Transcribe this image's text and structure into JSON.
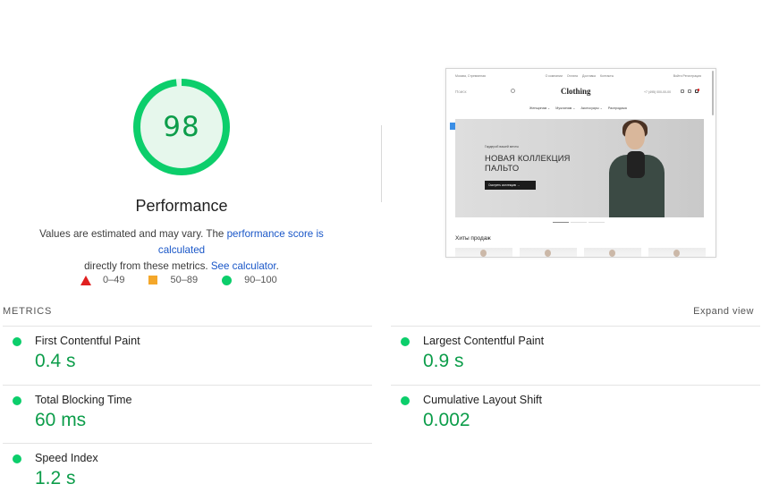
{
  "gauge": {
    "score": "98",
    "score_fraction": 0.98,
    "title": "Performance",
    "color": "#0cce6b"
  },
  "description": {
    "text_before": "Values are estimated and may vary. The ",
    "link_score": "performance score is calculated",
    "text_middle": " directly from these metrics. ",
    "link_calculator": "See calculator",
    "text_after": "."
  },
  "legend": [
    {
      "label": "0–49",
      "shape": "triangle-icon",
      "color": "#e02020"
    },
    {
      "label": "50–89",
      "shape": "square-icon",
      "color": "#f4a72a"
    },
    {
      "label": "90–100",
      "shape": "circle-icon",
      "color": "#0cce6b"
    }
  ],
  "screenshot": {
    "top_left": "Москва, Стремянная",
    "top_links": [
      "О компании",
      "Оплата",
      "Доставка",
      "Контакты"
    ],
    "top_right": "Войти  Регистрация",
    "search_placeholder": "Поиск",
    "logo": "Clothing",
    "phone": "+7 (495) 000-00-00",
    "menu": [
      "Женщинам ⌄",
      "Мужчинам ⌄",
      "Аксессуары ⌄",
      "Распродажа"
    ],
    "hero_pre": "Гардероб вашей мечты",
    "hero_title_line1": "НОВАЯ КОЛЛЕКЦИЯ",
    "hero_title_line2": "ПАЛЬТО",
    "hero_button": "Смотреть коллекцию  →",
    "section_title": "Хиты продаж"
  },
  "metrics": {
    "header": "METRICS",
    "expand_label": "Expand view",
    "items": [
      {
        "name": "First Contentful Paint",
        "value": "0.4 s"
      },
      {
        "name": "Largest Contentful Paint",
        "value": "0.9 s"
      },
      {
        "name": "Total Blocking Time",
        "value": "60 ms"
      },
      {
        "name": "Cumulative Layout Shift",
        "value": "0.002"
      },
      {
        "name": "Speed Index",
        "value": "1.2 s"
      }
    ],
    "status_color": "#0cce6b",
    "value_color": "#0c9d4a"
  }
}
